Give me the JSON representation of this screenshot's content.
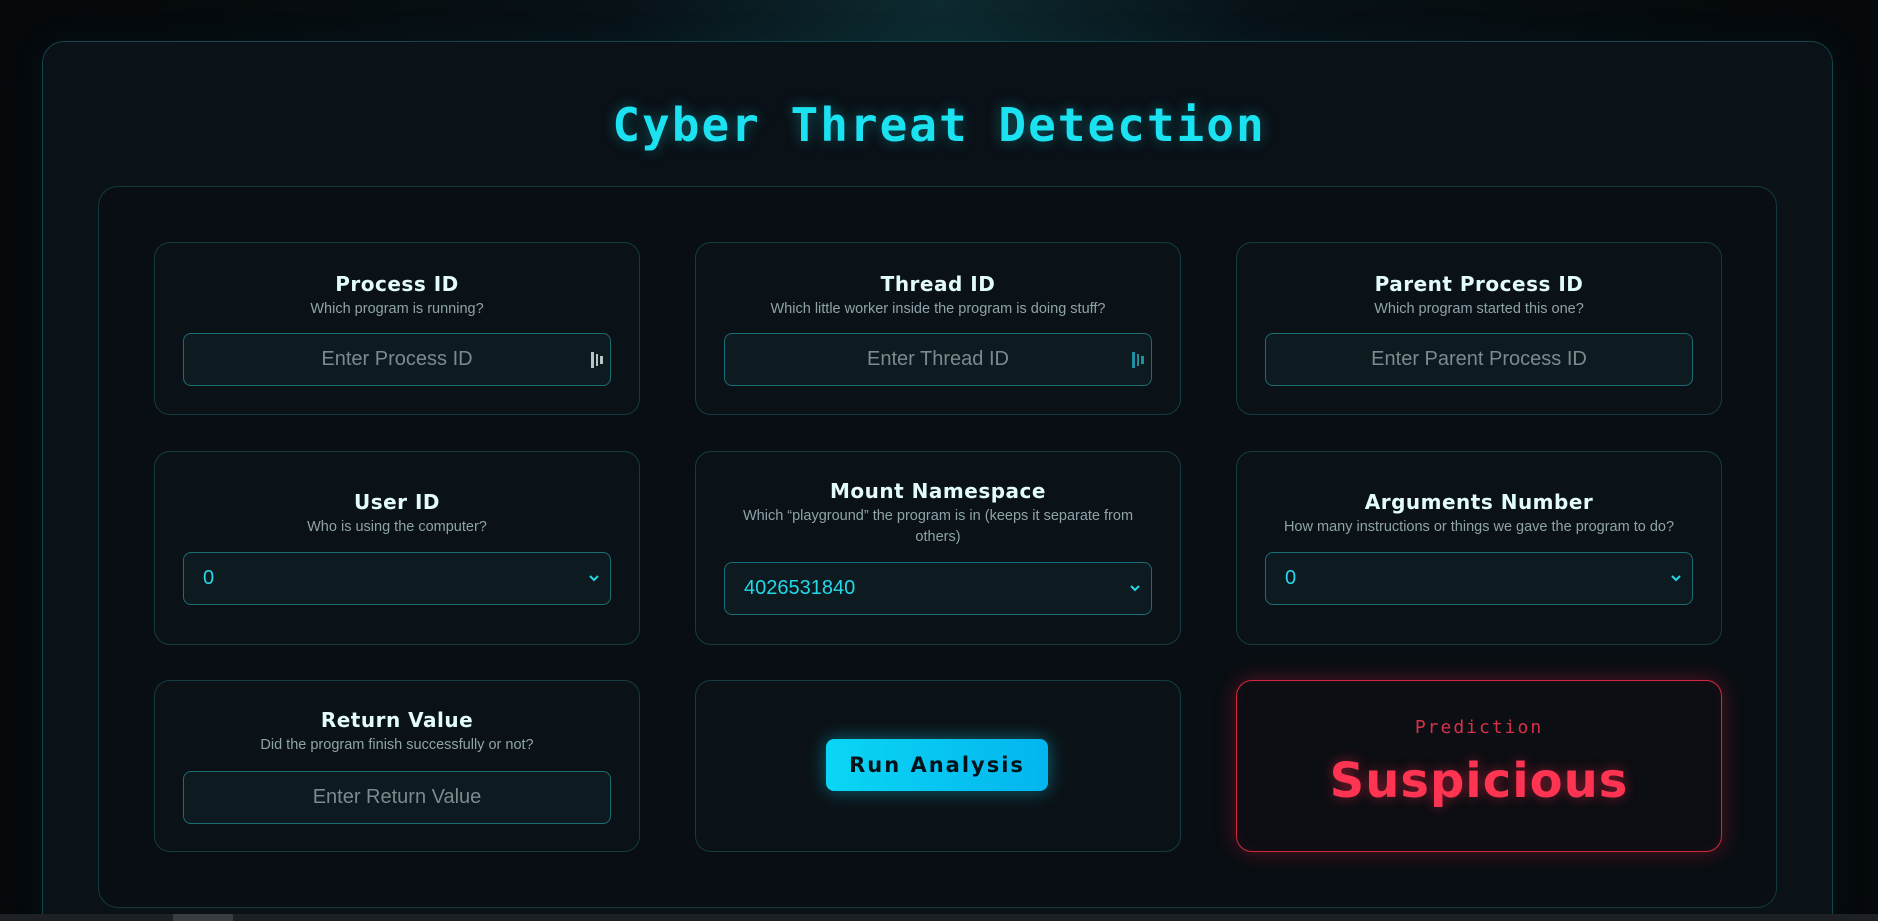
{
  "app": {
    "title": "Cyber Threat Detection"
  },
  "fields": {
    "process_id": {
      "label": "Process ID",
      "description": "Which program is running?",
      "placeholder": "Enter Process ID"
    },
    "thread_id": {
      "label": "Thread ID",
      "description": "Which little worker inside the program is doing stuff?",
      "placeholder": "Enter Thread ID"
    },
    "parent_process_id": {
      "label": "Parent Process ID",
      "description": "Which program started this one?",
      "placeholder": "Enter Parent Process ID"
    },
    "user_id": {
      "label": "User ID",
      "description": "Who is using the computer?",
      "selected": "0"
    },
    "mount_namespace": {
      "label": "Mount Namespace",
      "description": "Which “playground” the program is in (keeps it separate from others)",
      "selected": "4026531840"
    },
    "arguments_number": {
      "label": "Arguments Number",
      "description": "How many instructions or things we gave the program to do?",
      "selected": "0"
    },
    "return_value": {
      "label": "Return Value",
      "description": "Did the program finish successfully or not?",
      "placeholder": "Enter Return Value"
    }
  },
  "actions": {
    "run_label": "Run Analysis"
  },
  "prediction": {
    "label": "Prediction",
    "value": "Suspicious"
  },
  "colors": {
    "accent": "#1be2f0",
    "button": "#0ad6f4",
    "danger": "#ff3352",
    "panel_border": "#133c42"
  },
  "icons": {
    "password_manager": "password-manager-key-icon",
    "select_arrow": "chevron-down-icon"
  }
}
